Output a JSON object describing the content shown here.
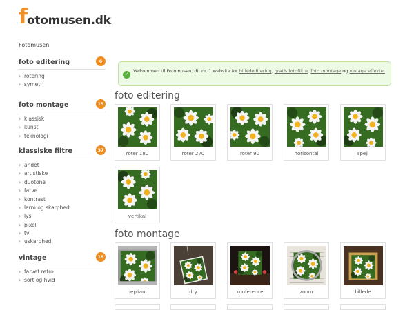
{
  "logo": {
    "f": "f",
    "rest": "otomusen.dk"
  },
  "breadcrumb": "Fotomusen",
  "sidebar": {
    "sections": [
      {
        "title": "foto editering",
        "count": "6",
        "items": [
          "rotering",
          "symetri"
        ]
      },
      {
        "title": "foto montage",
        "count": "15",
        "items": [
          "klassisk",
          "kunst",
          "teknologi"
        ]
      },
      {
        "title": "klassiske filtre",
        "count": "37",
        "items": [
          "andet",
          "artistiske",
          "duotone",
          "farve",
          "kontrast",
          "larm og skarphed",
          "lys",
          "pixel",
          "tv",
          "uskarphed"
        ]
      },
      {
        "title": "vintage",
        "count": "19",
        "items": [
          "farvet retro",
          "sort og hvid"
        ]
      }
    ]
  },
  "welcome": {
    "before": "Velkommen til Fotomusen, dit nr. 1 website for ",
    "link1": "billededitering",
    "sep1": ", ",
    "link2": "gratis fotofiltre",
    "sep2": ", ",
    "link3": "foto montage",
    "sep3": " og ",
    "link4": "vintage effekter",
    "after": "."
  },
  "gallery": {
    "editing": {
      "title": "foto editering",
      "tiles": [
        "roter 180",
        "roter 270",
        "roter 90",
        "horisontal",
        "spejl",
        "vertikal"
      ]
    },
    "montage": {
      "title": "foto montage",
      "tiles": [
        "depliant",
        "dry",
        "konference",
        "zoom",
        "billede"
      ]
    }
  },
  "colors": {
    "accent": "#f08c1e",
    "success_bg": "#eefbe4",
    "success_border": "#bfe2a2"
  }
}
